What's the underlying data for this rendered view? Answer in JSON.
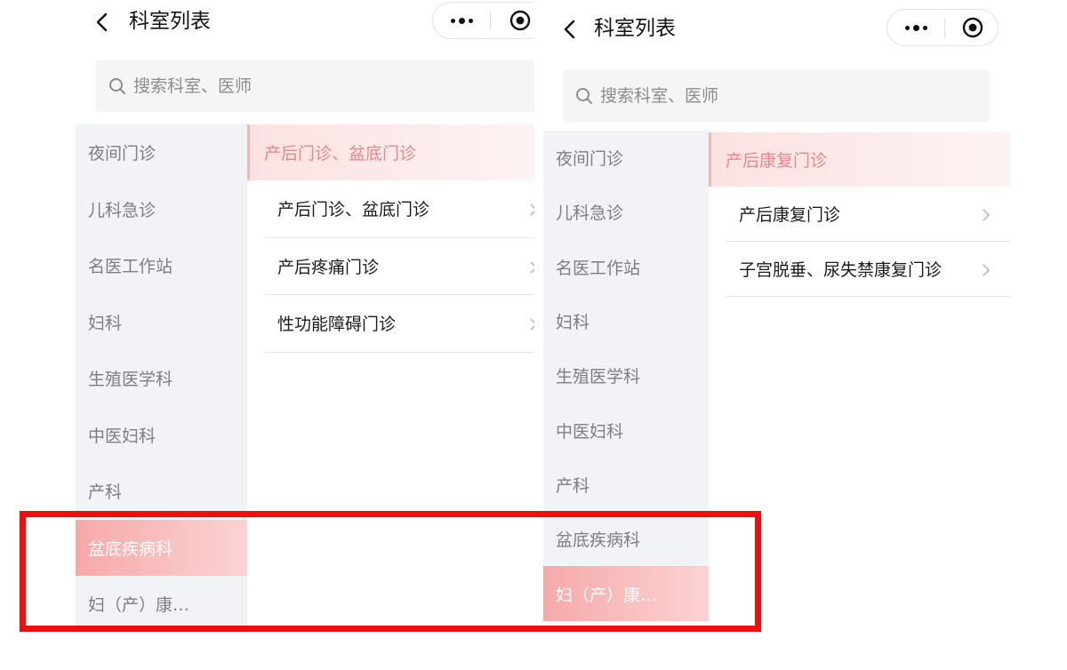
{
  "nav": {
    "title": "科室列表"
  },
  "search": {
    "placeholder": "搜索科室、医师"
  },
  "sidebar": {
    "items": [
      "夜间门诊",
      "儿科急诊",
      "名医工作站",
      "妇科",
      "生殖医学科",
      "中医妇科",
      "产科",
      "盆底疾病科",
      "妇（产）康…"
    ]
  },
  "left_panel": {
    "active_sidebar_item": "盆底疾病科",
    "category_header": "产后门诊、盆底门诊",
    "sub_items": [
      "产后门诊、盆底门诊",
      "产后疼痛门诊",
      "性功能障碍门诊"
    ]
  },
  "right_panel": {
    "active_sidebar_item": "妇（产）康…",
    "category_header": "产后康复门诊",
    "sub_items": [
      "产后康复门诊",
      "子宫脱垂、尿失禁康复门诊"
    ]
  },
  "colors": {
    "accent_pink": "#f7a9a9",
    "header_text": "#e8878a",
    "highlight_red": "#ee0f0f",
    "sidebar_bg": "#f2f3f7"
  },
  "icons": {
    "back": "chevron-left-icon",
    "more": "more-dots-icon",
    "close": "target-circle-icon",
    "search": "search-icon",
    "item_arrow": "chevron-right-icon"
  }
}
